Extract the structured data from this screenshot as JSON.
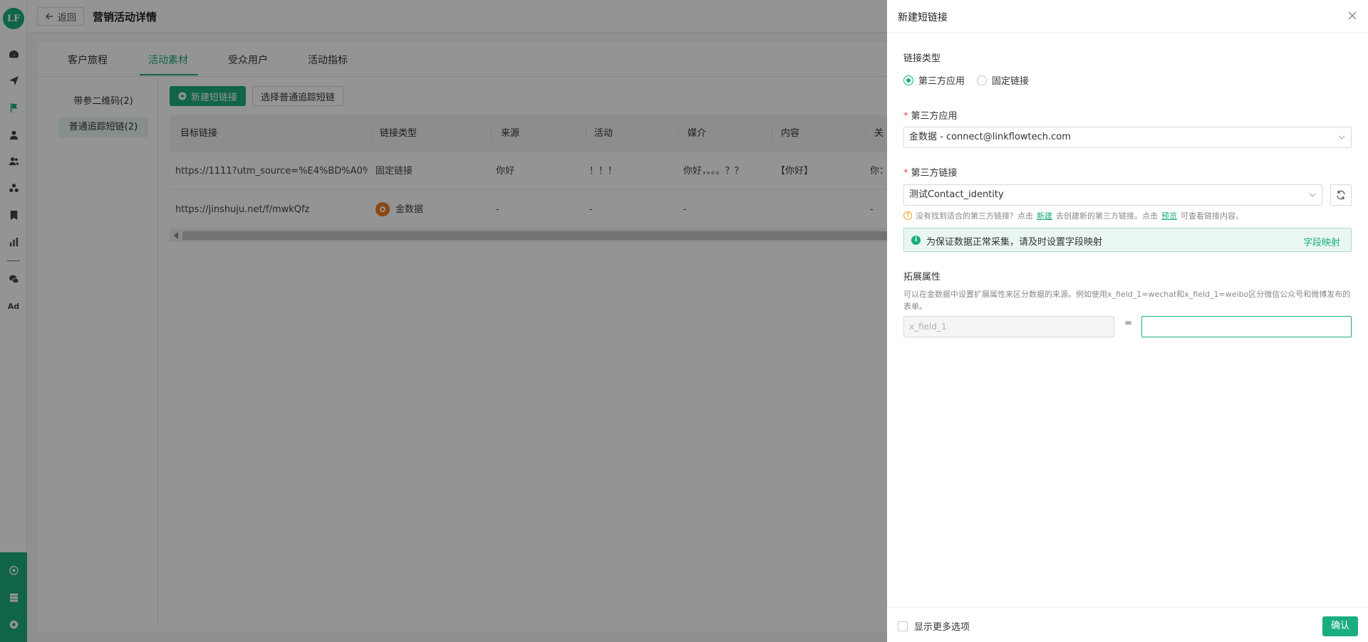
{
  "nav": {
    "logo": "LF",
    "ad_label": "Ad",
    "icons": [
      "dashboard-icon",
      "send-icon",
      "flag-icon",
      "user-icon",
      "users-icon",
      "segments-icon",
      "bookmark-icon",
      "chart-icon",
      "wechat-icon",
      "ad-icon"
    ],
    "bottom_icons": [
      "network-icon",
      "server-icon",
      "gear-icon"
    ]
  },
  "header": {
    "back_label": "返回",
    "title": "营销活动详情"
  },
  "tabs": [
    {
      "label": "客户旅程"
    },
    {
      "label": "活动素材"
    },
    {
      "label": "受众用户"
    },
    {
      "label": "活动指标"
    }
  ],
  "subnav": [
    {
      "label": "带参二维码(2)"
    },
    {
      "label": "普通追踪短链(2)"
    }
  ],
  "toolbar": {
    "new_link": "新建短链接",
    "select_link": "选择普通追踪短链"
  },
  "table": {
    "columns": [
      "目标链接",
      "链接类型",
      "来源",
      "活动",
      "媒介",
      "内容",
      "关"
    ],
    "rows": [
      [
        "https://1111?utm_source=%E4%BD%A0%E5...",
        "固定链接",
        "你好",
        "！！！",
        "你好，。。。？？",
        "【你好】",
        "你："
      ],
      [
        "https://jinshuju.net/f/mwkQfz",
        "金数据",
        "-",
        "-",
        "-",
        "",
        "-"
      ]
    ]
  },
  "drawer": {
    "title": "新建短链接",
    "link_type_label": "链接类型",
    "radio_third_party": "第三方应用",
    "radio_fixed": "固定链接",
    "third_party_app_label": "第三方应用",
    "third_party_app_value": "金数据 - connect@linkflowtech.com",
    "third_party_link_label": "第三方链接",
    "third_party_link_value": "测试Contact_identity",
    "hint_prefix": "没有找到适合的第三方链接？点击",
    "hint_new": "新建",
    "hint_middle": "去创建新的第三方链接。点击",
    "hint_preview": "预览",
    "hint_suffix": "可查看链接内容。",
    "alert_msg": "为保证数据正常采集，请及时设置字段映射",
    "alert_link": "字段映射",
    "ext_label": "拓展属性",
    "ext_desc": "可以在金数据中设置扩展属性来区分数据的来源。例如使用x_field_1=wechat和x_field_1=weibo区分微信公众号和微博发布的表单。",
    "ext_key": "x_field_1",
    "eq": "=",
    "ext_value": "",
    "show_more": "显示更多选项",
    "confirm": "确认"
  },
  "colors": {
    "brand": "#1aad7f",
    "required": "#e34d4d"
  }
}
